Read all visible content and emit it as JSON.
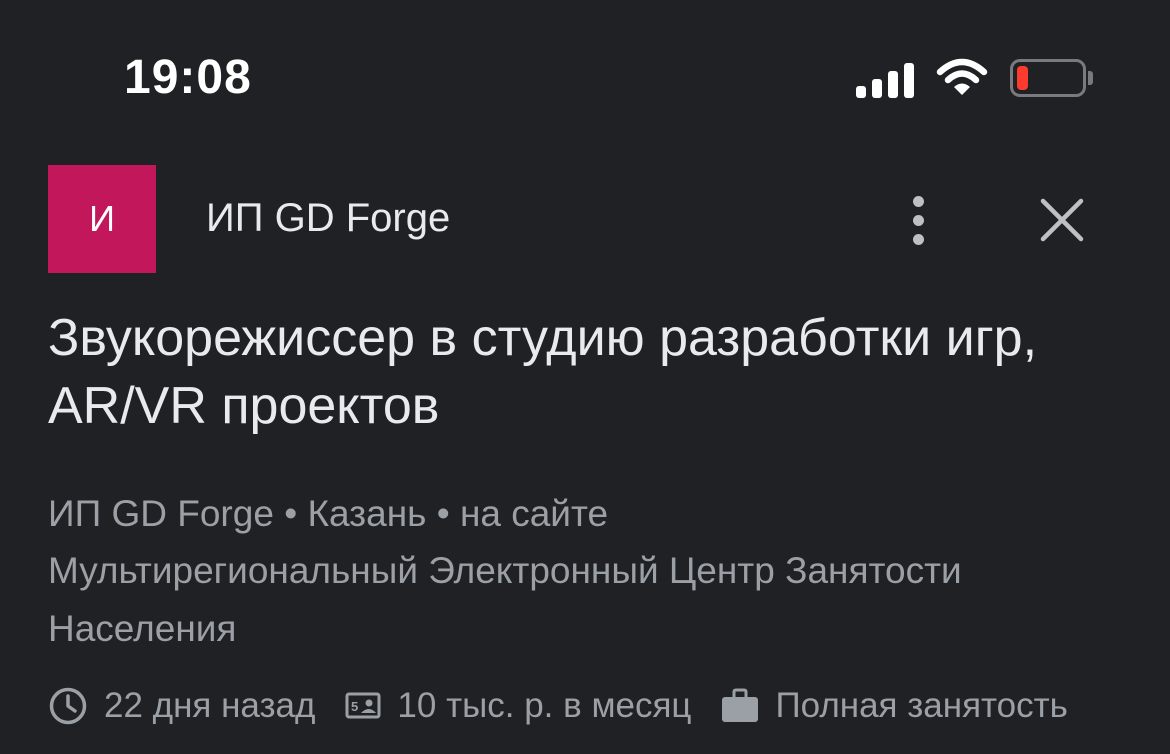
{
  "status_bar": {
    "time": "19:08",
    "icons": [
      "signal-icon",
      "wifi-icon",
      "battery-low-icon"
    ],
    "battery_color": "#ff3b30"
  },
  "job_card": {
    "logo_letter": "И",
    "logo_color": "#c2185b",
    "company": "ИП GD Forge",
    "title": "Звукорежиссер в студию разработки игр, AR/VR проектов",
    "meta": {
      "company": "ИП GD Forge",
      "separator": "•",
      "city": "Казань",
      "site": "на сайте"
    },
    "source": "Мультирегиональный Электронный Центр Занятости Населения",
    "details": {
      "posted": "22 дня назад",
      "salary": "10 тыс. р. в месяц",
      "employment": "Полная занятость"
    },
    "actions": [
      "more-vert-icon",
      "close-icon"
    ]
  }
}
